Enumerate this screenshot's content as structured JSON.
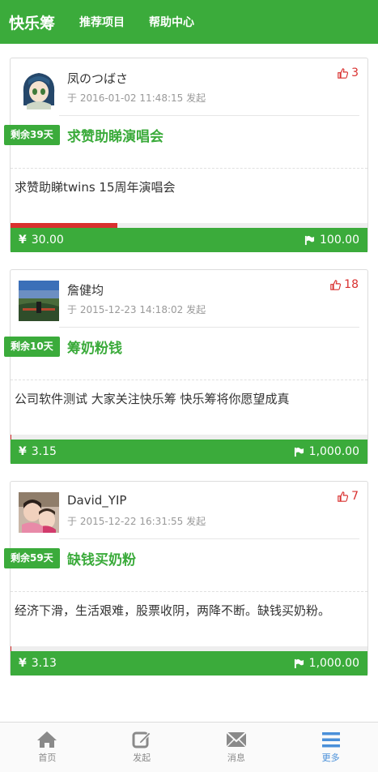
{
  "header": {
    "brand": "快乐筹",
    "nav": [
      "推荐项目",
      "帮助中心"
    ]
  },
  "colors": {
    "primary": "#3bab3b",
    "danger": "#d9302f",
    "active_tab": "#4a90d9"
  },
  "projects": [
    {
      "user": "凤のつばさ",
      "date": "于 2016-01-02 11:48:15 发起",
      "likes": "3",
      "badge": "剩余39天",
      "title": "求赞助睇演唱会",
      "description": "求赞助睇twins 15周年演唱会",
      "raised": "30.00",
      "goal": "100.00",
      "progress_percent": 30
    },
    {
      "user": "詹健均",
      "date": "于 2015-12-23 14:18:02 发起",
      "likes": "18",
      "badge": "剩余10天",
      "title": "筹奶粉钱",
      "description": "公司软件测试 大家关注快乐筹 快乐筹将你愿望成真",
      "raised": "3.15",
      "goal": "1,000.00",
      "progress_percent": 0.3
    },
    {
      "user": "David_YIP",
      "date": "于 2015-12-22 16:31:55 发起",
      "likes": "7",
      "badge": "剩余59天",
      "title": "缺钱买奶粉",
      "description": "经济下滑，生活艰难，股票收阴，两降不断。缺钱买奶粉。",
      "raised": "3.13",
      "goal": "1,000.00",
      "progress_percent": 0.3
    }
  ],
  "tabbar": [
    {
      "label": "首页",
      "icon": "home-icon"
    },
    {
      "label": "发起",
      "icon": "edit-icon"
    },
    {
      "label": "消息",
      "icon": "mail-icon"
    },
    {
      "label": "更多",
      "icon": "menu-icon",
      "active": true
    }
  ]
}
